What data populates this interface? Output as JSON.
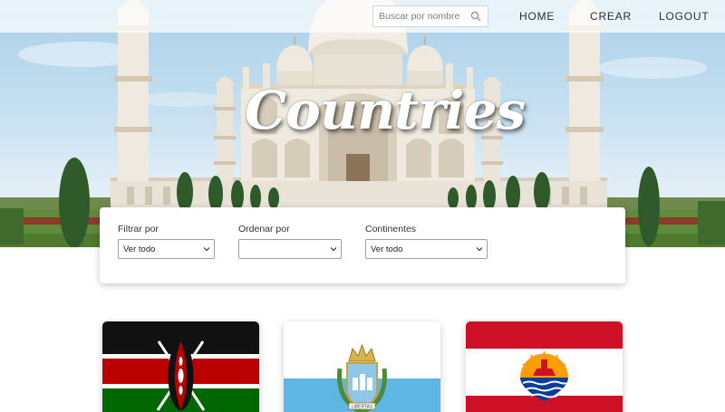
{
  "nav": {
    "search_placeholder": "Buscar por nombre",
    "links": [
      "HOME",
      "CREAR",
      "LOGOUT"
    ]
  },
  "hero": {
    "title": "Countries"
  },
  "filters": {
    "filter_by": {
      "label": "Filtrar por",
      "selected": "Ver todo"
    },
    "order_by": {
      "label": "Ordenar por",
      "selected": ""
    },
    "continents": {
      "label": "Continentes",
      "selected": "Ver todo"
    }
  },
  "cards": [
    {
      "flag_icon": "kenya-flag"
    },
    {
      "flag_icon": "san-marino-flag",
      "emblem_text": "LIBERTAS"
    },
    {
      "flag_icon": "french-polynesia-flag"
    }
  ],
  "colors": {
    "sky": "#a9cfe9",
    "marble": "#efe9e0",
    "nav_bg": "#ffffff",
    "text": "#2b2f33"
  }
}
